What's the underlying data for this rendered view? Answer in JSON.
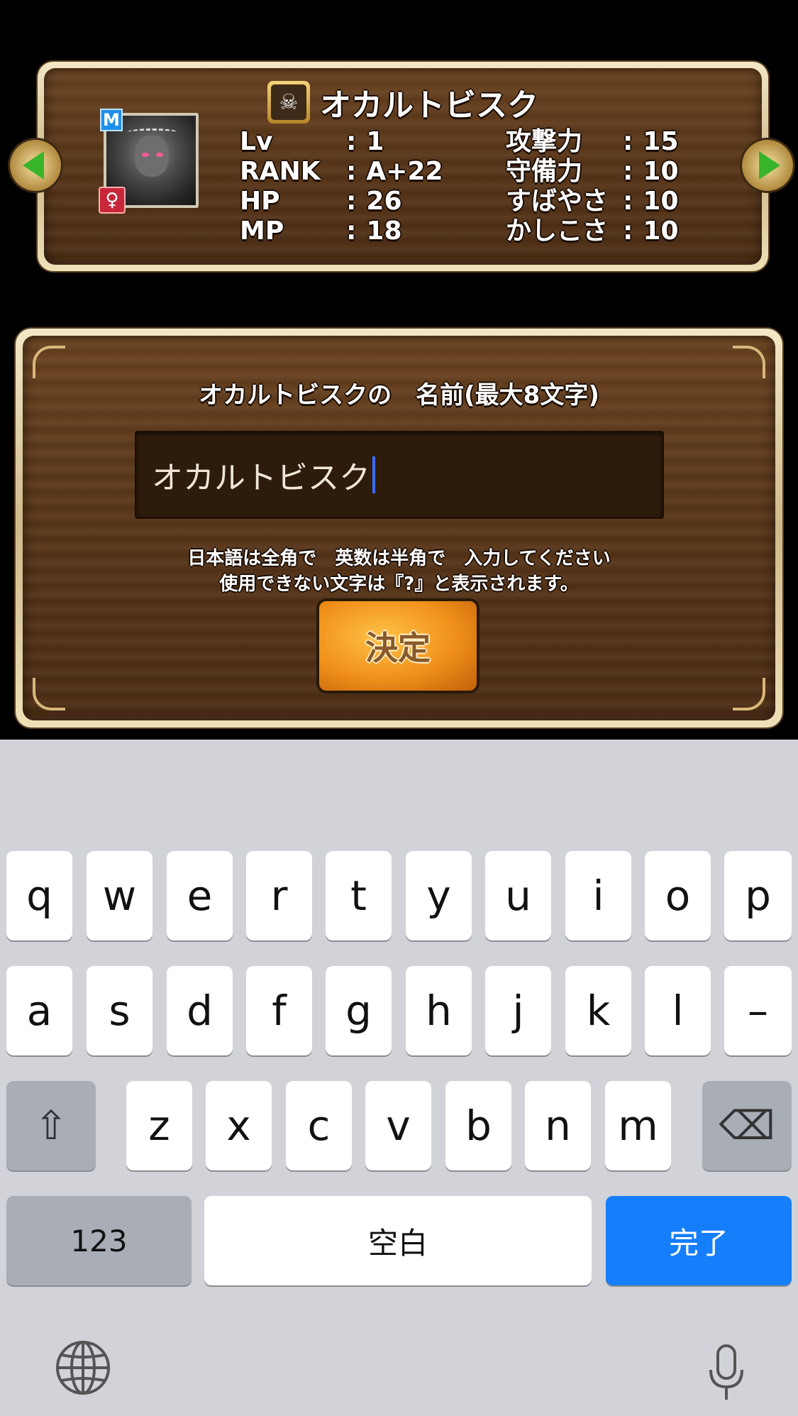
{
  "status_panel": {
    "title": "オカルトビスク",
    "title_icon": "skull-icon",
    "type_badge": "M",
    "gender_badge": "♀",
    "stats_left": [
      {
        "label": "Lv",
        "value": "1"
      },
      {
        "label": "RANK",
        "value": "A+22"
      },
      {
        "label": "HP",
        "value": "26"
      },
      {
        "label": "MP",
        "value": "18"
      }
    ],
    "stats_right": [
      {
        "label": "攻撃力",
        "value": "15"
      },
      {
        "label": "守備力",
        "value": "10"
      },
      {
        "label": "すばやさ",
        "value": "10"
      },
      {
        "label": "かしこさ",
        "value": "10"
      }
    ]
  },
  "dialog": {
    "title": "オカルトビスクの　名前(最大8文字)",
    "input_value": "オカルトビスク",
    "hint_line1": "日本語は全角で　英数は半角で　入力してください",
    "hint_line2": "使用できない文字は『?』と表示されます。",
    "confirm_label": "決定"
  },
  "keyboard": {
    "row1": [
      "q",
      "w",
      "e",
      "r",
      "t",
      "y",
      "u",
      "i",
      "o",
      "p"
    ],
    "row2": [
      "a",
      "s",
      "d",
      "f",
      "g",
      "h",
      "j",
      "k",
      "l",
      "–"
    ],
    "row3": [
      "z",
      "x",
      "c",
      "v",
      "b",
      "n",
      "m"
    ],
    "shift_icon": "⇧",
    "delete_icon": "⌫",
    "numbers_label": "123",
    "space_label": "空白",
    "done_label": "完了",
    "globe_icon": "globe-icon",
    "mic_icon": "microphone-icon",
    "done_color": "#157efb"
  }
}
